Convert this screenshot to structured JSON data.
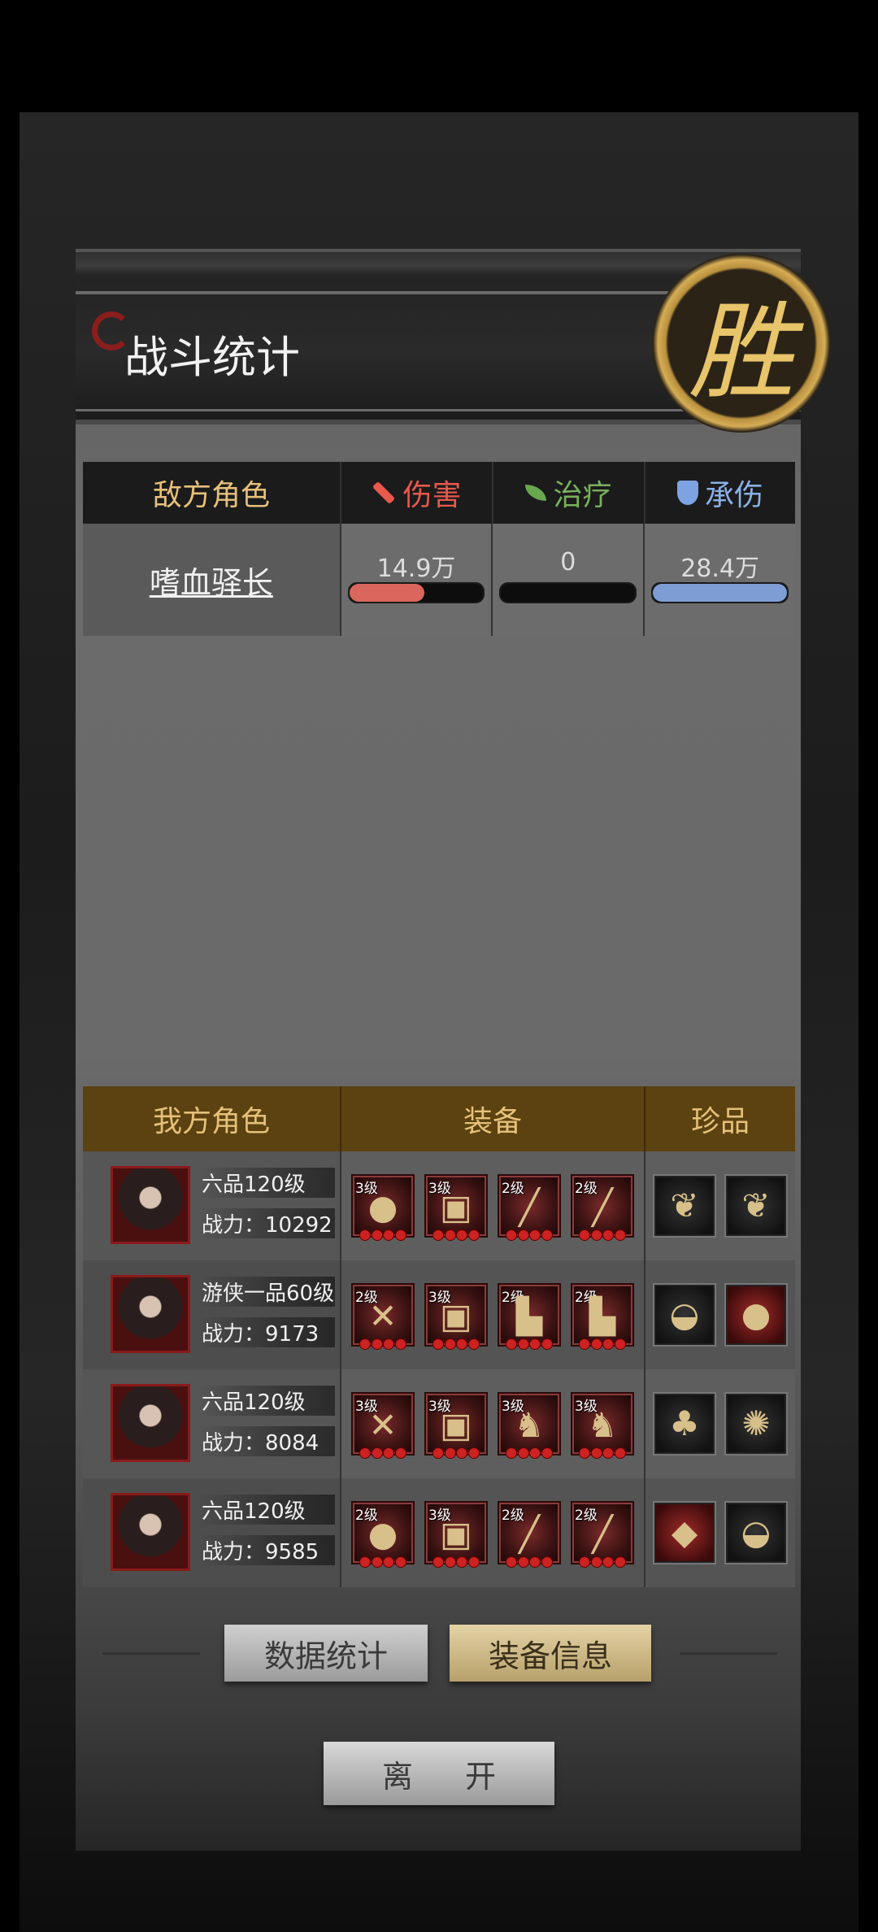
{
  "title": "战斗统计",
  "victory_mark": "胜",
  "enemy_table": {
    "headers": {
      "role": "敌方角色",
      "damage": "伤害",
      "heal": "治疗",
      "tank": "承伤"
    },
    "rows": [
      {
        "name": "嗜血驿长",
        "damage": "14.9万",
        "heal": "0",
        "tank": "28.4万",
        "damage_fill": 0.56,
        "heal_fill": 0,
        "tank_fill": 1.0
      }
    ]
  },
  "ally_table": {
    "headers": {
      "role": "我方角色",
      "equipment": "装备",
      "treasure": "珍品"
    },
    "rows": [
      {
        "rank": "六品120级",
        "power": "战力：10292",
        "equipment": [
          {
            "lvl": "3级",
            "icon": "gourd-icon"
          },
          {
            "lvl": "3级",
            "icon": "armor-icon"
          },
          {
            "lvl": "2级",
            "icon": "spear-icon"
          },
          {
            "lvl": "2级",
            "icon": "spear-icon"
          }
        ],
        "treasure": [
          {
            "icon": "feather-icon"
          },
          {
            "icon": "feather-icon"
          }
        ]
      },
      {
        "rank": "游侠一品60级",
        "power": "战力：9173",
        "equipment": [
          {
            "lvl": "2级",
            "icon": "crossbow-icon"
          },
          {
            "lvl": "3级",
            "icon": "armor-icon"
          },
          {
            "lvl": "2级",
            "icon": "boots-icon"
          },
          {
            "lvl": "2级",
            "icon": "boots-icon"
          }
        ],
        "treasure": [
          {
            "icon": "shell-icon"
          },
          {
            "icon": "fruit-icon",
            "red": true
          }
        ]
      },
      {
        "rank": "六品120级",
        "power": "战力：8084",
        "equipment": [
          {
            "lvl": "3级",
            "icon": "crossbow-icon"
          },
          {
            "lvl": "3级",
            "icon": "armor-icon"
          },
          {
            "lvl": "3级",
            "icon": "horse-icon"
          },
          {
            "lvl": "3级",
            "icon": "horse-icon"
          }
        ],
        "treasure": [
          {
            "icon": "mushroom-icon"
          },
          {
            "icon": "fan-icon"
          }
        ]
      },
      {
        "rank": "六品120级",
        "power": "战力：9585",
        "equipment": [
          {
            "lvl": "2级",
            "icon": "gourd-icon"
          },
          {
            "lvl": "3级",
            "icon": "armor-icon"
          },
          {
            "lvl": "2级",
            "icon": "spear-icon"
          },
          {
            "lvl": "2级",
            "icon": "spear-icon"
          }
        ],
        "treasure": [
          {
            "icon": "bird-icon",
            "red": true
          },
          {
            "icon": "shell-icon"
          }
        ]
      }
    ]
  },
  "buttons": {
    "data_stats": "数据统计",
    "equip_info": "装备信息",
    "leave": "离 开"
  }
}
